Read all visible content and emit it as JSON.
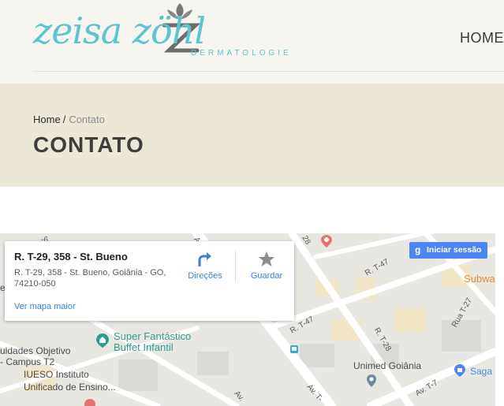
{
  "header": {
    "logo": {
      "name": "zeisa zöhl",
      "subtitle": "DERMATOLOGIE"
    },
    "nav": {
      "home_label": "HOME"
    }
  },
  "breadcrumb": {
    "home": "Home",
    "separator": "/",
    "current": "Contato"
  },
  "page": {
    "title": "CONTATO"
  },
  "map": {
    "card": {
      "title": "R. T-29, 358 - St. Bueno",
      "address": "R. T-29, 358 - St. Bueno, Goiânia - GO, 74210-050",
      "directions_label": "Direções",
      "save_label": "Guardar",
      "larger_map_label": "Ver mapa maior"
    },
    "signin_label": "Iniciar sessão",
    "labels": {
      "super": "Super Fantástico",
      "buffet": "Buffet Infantil",
      "objetivo1": "uldades Objetivo",
      "objetivo2": "- Campus T2",
      "iueso1": "IUESO Instituto",
      "iueso2": "Unificado de Ensino...",
      "unimed": "Unimed Goiânia",
      "saga": "Saga",
      "subway": "Subwa",
      "rt47a": "R. T-47",
      "rt47b": "R. T-47",
      "rt28": "R. T-28",
      "rt27": "Rua T-27",
      "avt7": "Av. T-7",
      "avt7b": "Av. T-",
      "av1": "Av.",
      "av2": "Av.",
      "num28": "28",
      "num6": "-6",
      "vo": "vo",
      "letter_e": "e"
    },
    "colors": {
      "teal": "#2f9b92",
      "link": "#3a7fd5",
      "signin": "#4b86f2",
      "pin_red": "#e57373"
    }
  }
}
